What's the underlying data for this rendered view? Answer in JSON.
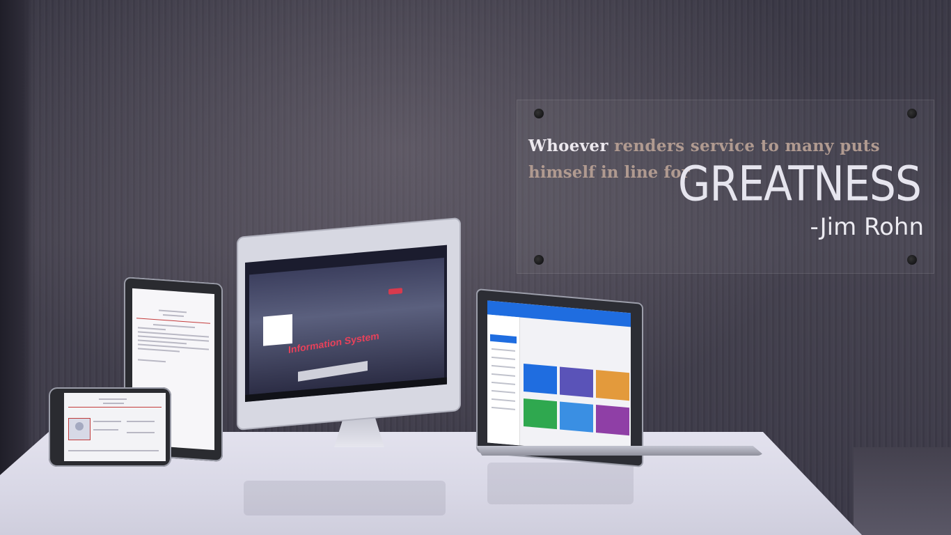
{
  "quote": {
    "first_word": "Whoever",
    "line1_rest": "renders service to many puts",
    "line2": "himself in line for",
    "highlight": "GREATNESS",
    "author": "-Jim Rohn"
  },
  "monitor": {
    "headline": "Information System"
  },
  "colors": {
    "wall": "#3f3d4a",
    "table": "#e1e0ec",
    "accent_red": "#e8415a",
    "laptop_blue": "#1f6de0"
  },
  "laptop_tiles": [
    {
      "name": "tile-population",
      "color": "#1f6de0"
    },
    {
      "name": "tile-male",
      "color": "#5a53b8"
    },
    {
      "name": "tile-female",
      "color": "#e39a3c"
    },
    {
      "name": "tile-voters",
      "color": "#2fa84f"
    },
    {
      "name": "tile-non-voters",
      "color": "#3a8fe3"
    },
    {
      "name": "tile-third",
      "color": "#8f3fa6"
    }
  ]
}
